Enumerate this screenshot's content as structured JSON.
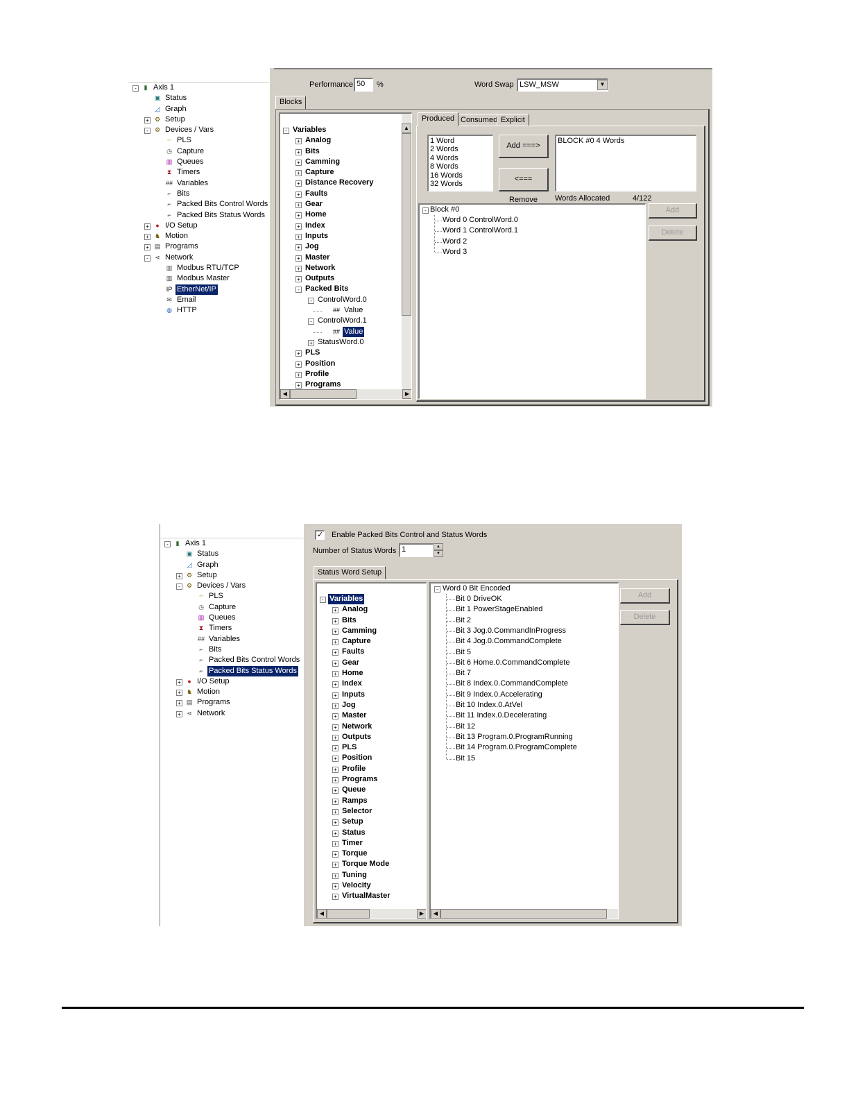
{
  "top": {
    "nav_tree": [
      {
        "label": "Axis 1",
        "icon": "axis-icon",
        "level": 0,
        "exp": "-"
      },
      {
        "label": "Status",
        "icon": "status-monitor-icon",
        "level": 1,
        "exp": ""
      },
      {
        "label": "Graph",
        "icon": "graph-icon",
        "level": 1,
        "exp": ""
      },
      {
        "label": "Setup",
        "icon": "setup-icon",
        "level": 1,
        "exp": "+"
      },
      {
        "label": "Devices / Vars",
        "icon": "devices-icon",
        "level": 1,
        "exp": "-"
      },
      {
        "label": "PLS",
        "icon": "pls-icon",
        "level": 2,
        "exp": ""
      },
      {
        "label": "Capture",
        "icon": "capture-icon",
        "level": 2,
        "exp": ""
      },
      {
        "label": "Queues",
        "icon": "queues-icon",
        "level": 2,
        "exp": ""
      },
      {
        "label": "Timers",
        "icon": "timers-icon",
        "level": 2,
        "exp": ""
      },
      {
        "label": "Variables",
        "icon": "variables-icon",
        "level": 2,
        "exp": ""
      },
      {
        "label": "Bits",
        "icon": "bits-icon",
        "level": 2,
        "exp": ""
      },
      {
        "label": "Packed Bits Control Words",
        "icon": "packed-bits-icon",
        "level": 2,
        "exp": ""
      },
      {
        "label": "Packed Bits Status Words",
        "icon": "packed-bits-icon",
        "level": 2,
        "exp": ""
      },
      {
        "label": "I/O Setup",
        "icon": "io-setup-icon",
        "level": 1,
        "exp": "+"
      },
      {
        "label": "Motion",
        "icon": "motion-icon",
        "level": 1,
        "exp": "+"
      },
      {
        "label": "Programs",
        "icon": "programs-icon",
        "level": 1,
        "exp": "+"
      },
      {
        "label": "Network",
        "icon": "network-icon",
        "level": 1,
        "exp": "-"
      },
      {
        "label": "Modbus RTU/TCP",
        "icon": "modbus-icon",
        "level": 2,
        "exp": ""
      },
      {
        "label": "Modbus Master",
        "icon": "modbus-icon",
        "level": 2,
        "exp": ""
      },
      {
        "label": "EtherNet/IP",
        "icon": "ethernet-ip-icon",
        "level": 2,
        "exp": "",
        "selected": true
      },
      {
        "label": "Email",
        "icon": "email-icon",
        "level": 2,
        "exp": ""
      },
      {
        "label": "HTTP",
        "icon": "http-globe-icon",
        "level": 2,
        "exp": ""
      }
    ],
    "performance_label": "Performance",
    "performance_value": "50",
    "performance_unit": "%",
    "word_swap_label": "Word Swap",
    "word_swap_value": "LSW_MSW",
    "blocks_tab": "Blocks",
    "var_tree": [
      {
        "label": "Variables",
        "level": 0,
        "exp": "-",
        "bold": true
      },
      {
        "label": "Analog",
        "level": 1,
        "exp": "+",
        "bold": true
      },
      {
        "label": "Bits",
        "level": 1,
        "exp": "+",
        "bold": true
      },
      {
        "label": "Camming",
        "level": 1,
        "exp": "+",
        "bold": true
      },
      {
        "label": "Capture",
        "level": 1,
        "exp": "+",
        "bold": true
      },
      {
        "label": "Distance Recovery",
        "level": 1,
        "exp": "+",
        "bold": true
      },
      {
        "label": "Faults",
        "level": 1,
        "exp": "+",
        "bold": true
      },
      {
        "label": "Gear",
        "level": 1,
        "exp": "+",
        "bold": true
      },
      {
        "label": "Home",
        "level": 1,
        "exp": "+",
        "bold": true
      },
      {
        "label": "Index",
        "level": 1,
        "exp": "+",
        "bold": true
      },
      {
        "label": "Inputs",
        "level": 1,
        "exp": "+",
        "bold": true
      },
      {
        "label": "Jog",
        "level": 1,
        "exp": "+",
        "bold": true
      },
      {
        "label": "Master",
        "level": 1,
        "exp": "+",
        "bold": true
      },
      {
        "label": "Network",
        "level": 1,
        "exp": "+",
        "bold": true
      },
      {
        "label": "Outputs",
        "level": 1,
        "exp": "+",
        "bold": true
      },
      {
        "label": "Packed Bits",
        "level": 1,
        "exp": "-",
        "bold": true
      },
      {
        "label": "ControlWord.0",
        "level": 2,
        "exp": "-",
        "bold": false
      },
      {
        "label": "Value",
        "level": 3,
        "exp": "",
        "bold": false,
        "icon": "##"
      },
      {
        "label": "ControlWord.1",
        "level": 2,
        "exp": "-",
        "bold": false
      },
      {
        "label": "Value",
        "level": 3,
        "exp": "",
        "bold": false,
        "icon": "##",
        "selected": true
      },
      {
        "label": "StatusWord.0",
        "level": 2,
        "exp": "+",
        "bold": false
      },
      {
        "label": "PLS",
        "level": 1,
        "exp": "+",
        "bold": true
      },
      {
        "label": "Position",
        "level": 1,
        "exp": "+",
        "bold": true
      },
      {
        "label": "Profile",
        "level": 1,
        "exp": "+",
        "bold": true
      },
      {
        "label": "Programs",
        "level": 1,
        "exp": "+",
        "bold": true
      }
    ],
    "tabs": [
      "Produced",
      "Consumed",
      "Explicit"
    ],
    "word_sizes": [
      "1  Word",
      "2  Words",
      "4  Words",
      "8  Words",
      "16  Words",
      "32  Words"
    ],
    "add_button": "Add ===>",
    "remove_button": "<=== Remove",
    "block_list": [
      "BLOCK #0  4 Words"
    ],
    "words_allocated_label": "Words Allocated",
    "words_allocated_value": "4/122",
    "block_tree_root": "Block #0",
    "block_tree_items": [
      "Word 0  ControlWord.0",
      "Word 1  ControlWord.1",
      "Word 2",
      "Word 3"
    ],
    "add_small": "Add",
    "delete_small": "Delete"
  },
  "bottom": {
    "nav_tree": [
      {
        "label": "Axis 1",
        "icon": "axis-icon",
        "level": 0,
        "exp": "-"
      },
      {
        "label": "Status",
        "icon": "status-monitor-icon",
        "level": 1,
        "exp": ""
      },
      {
        "label": "Graph",
        "icon": "graph-icon",
        "level": 1,
        "exp": ""
      },
      {
        "label": "Setup",
        "icon": "setup-icon",
        "level": 1,
        "exp": "+"
      },
      {
        "label": "Devices / Vars",
        "icon": "devices-icon",
        "level": 1,
        "exp": "-"
      },
      {
        "label": "PLS",
        "icon": "pls-icon",
        "level": 2,
        "exp": ""
      },
      {
        "label": "Capture",
        "icon": "capture-icon",
        "level": 2,
        "exp": ""
      },
      {
        "label": "Queues",
        "icon": "queues-icon",
        "level": 2,
        "exp": ""
      },
      {
        "label": "Timers",
        "icon": "timers-icon",
        "level": 2,
        "exp": ""
      },
      {
        "label": "Variables",
        "icon": "variables-icon",
        "level": 2,
        "exp": ""
      },
      {
        "label": "Bits",
        "icon": "bits-icon",
        "level": 2,
        "exp": ""
      },
      {
        "label": "Packed Bits Control Words",
        "icon": "packed-bits-icon",
        "level": 2,
        "exp": ""
      },
      {
        "label": "Packed Bits Status Words",
        "icon": "packed-bits-icon",
        "level": 2,
        "exp": "",
        "selected": true
      },
      {
        "label": "I/O Setup",
        "icon": "io-setup-icon",
        "level": 1,
        "exp": "+"
      },
      {
        "label": "Motion",
        "icon": "motion-icon",
        "level": 1,
        "exp": "+"
      },
      {
        "label": "Programs",
        "icon": "programs-icon",
        "level": 1,
        "exp": "+"
      },
      {
        "label": "Network",
        "icon": "network-icon",
        "level": 1,
        "exp": "+"
      }
    ],
    "enable_checkbox_label": "Enable Packed Bits Control and Status Words",
    "enable_checked": true,
    "num_status_words_label": "Number of Status Words",
    "num_status_words_value": "1",
    "status_tab": "Status Word Setup",
    "var_tree": [
      {
        "label": "Variables",
        "level": 0,
        "exp": "-",
        "bold": true,
        "selected": true
      },
      {
        "label": "Analog",
        "level": 1,
        "exp": "+",
        "bold": true
      },
      {
        "label": "Bits",
        "level": 1,
        "exp": "+",
        "bold": true
      },
      {
        "label": "Camming",
        "level": 1,
        "exp": "+",
        "bold": true
      },
      {
        "label": "Capture",
        "level": 1,
        "exp": "+",
        "bold": true
      },
      {
        "label": "Faults",
        "level": 1,
        "exp": "+",
        "bold": true
      },
      {
        "label": "Gear",
        "level": 1,
        "exp": "+",
        "bold": true
      },
      {
        "label": "Home",
        "level": 1,
        "exp": "+",
        "bold": true
      },
      {
        "label": "Index",
        "level": 1,
        "exp": "+",
        "bold": true
      },
      {
        "label": "Inputs",
        "level": 1,
        "exp": "+",
        "bold": true
      },
      {
        "label": "Jog",
        "level": 1,
        "exp": "+",
        "bold": true
      },
      {
        "label": "Master",
        "level": 1,
        "exp": "+",
        "bold": true
      },
      {
        "label": "Network",
        "level": 1,
        "exp": "+",
        "bold": true
      },
      {
        "label": "Outputs",
        "level": 1,
        "exp": "+",
        "bold": true
      },
      {
        "label": "PLS",
        "level": 1,
        "exp": "+",
        "bold": true
      },
      {
        "label": "Position",
        "level": 1,
        "exp": "+",
        "bold": true
      },
      {
        "label": "Profile",
        "level": 1,
        "exp": "+",
        "bold": true
      },
      {
        "label": "Programs",
        "level": 1,
        "exp": "+",
        "bold": true
      },
      {
        "label": "Queue",
        "level": 1,
        "exp": "+",
        "bold": true
      },
      {
        "label": "Ramps",
        "level": 1,
        "exp": "+",
        "bold": true
      },
      {
        "label": "Selector",
        "level": 1,
        "exp": "+",
        "bold": true
      },
      {
        "label": "Setup",
        "level": 1,
        "exp": "+",
        "bold": true
      },
      {
        "label": "Status",
        "level": 1,
        "exp": "+",
        "bold": true
      },
      {
        "label": "Timer",
        "level": 1,
        "exp": "+",
        "bold": true
      },
      {
        "label": "Torque",
        "level": 1,
        "exp": "+",
        "bold": true
      },
      {
        "label": "Torque Mode",
        "level": 1,
        "exp": "+",
        "bold": true
      },
      {
        "label": "Tuning",
        "level": 1,
        "exp": "+",
        "bold": true
      },
      {
        "label": "Velocity",
        "level": 1,
        "exp": "+",
        "bold": true
      },
      {
        "label": "VirtualMaster",
        "level": 1,
        "exp": "+",
        "bold": true
      }
    ],
    "word_root": "Word 0  Bit Encoded",
    "bits": [
      "Bit 0  DriveOK",
      "Bit 1  PowerStageEnabled",
      "Bit 2",
      "Bit 3  Jog.0.CommandInProgress",
      "Bit 4  Jog.0.CommandComplete",
      "Bit 5",
      "Bit 6  Home.0.CommandComplete",
      "Bit 7",
      "Bit 8  Index.0.CommandComplete",
      "Bit 9  Index.0.Accelerating",
      "Bit 10  Index.0.AtVel",
      "Bit 11  Index.0.Decelerating",
      "Bit 12",
      "Bit 13  Program.0.ProgramRunning",
      "Bit 14  Program.0.ProgramComplete",
      "Bit 15"
    ],
    "add_small": "Add",
    "delete_small": "Delete"
  },
  "colors": {
    "dialog_bg": "#d4d0c8",
    "selection": "#0a246a",
    "accent_line": "#000000"
  }
}
